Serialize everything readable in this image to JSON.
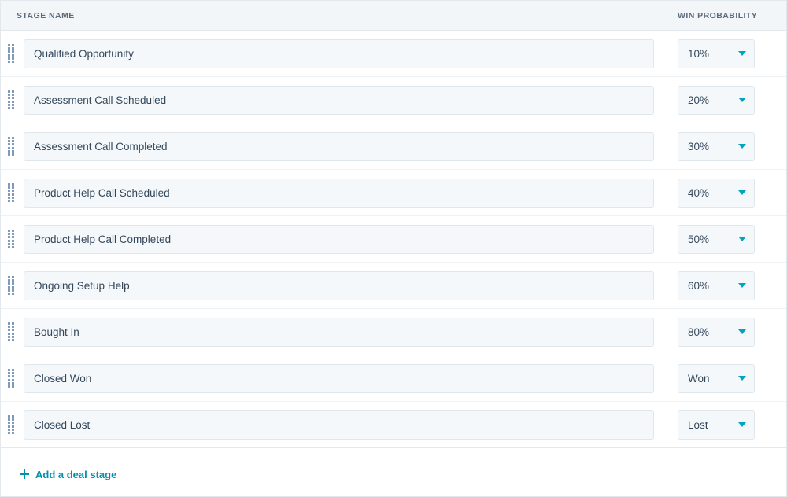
{
  "table": {
    "columns": {
      "stage_name": "STAGE NAME",
      "win_probability": "WIN PROBABILITY"
    },
    "rows": [
      {
        "stage_name": "Qualified Opportunity",
        "win_probability": "10%"
      },
      {
        "stage_name": "Assessment Call Scheduled",
        "win_probability": "20%"
      },
      {
        "stage_name": "Assessment Call Completed",
        "win_probability": "30%"
      },
      {
        "stage_name": "Product Help Call Scheduled",
        "win_probability": "40%"
      },
      {
        "stage_name": "Product Help Call Completed",
        "win_probability": "50%"
      },
      {
        "stage_name": "Ongoing Setup Help",
        "win_probability": "60%"
      },
      {
        "stage_name": "Bought In",
        "win_probability": "80%"
      },
      {
        "stage_name": "Closed Won",
        "win_probability": "Won"
      },
      {
        "stage_name": "Closed Lost",
        "win_probability": "Lost"
      }
    ]
  },
  "footer": {
    "add_stage_label": "Add a deal stage"
  },
  "colors": {
    "accent": "#00a4bd",
    "link": "#0091ae",
    "text": "#33475b",
    "header_text": "#5b6b7c",
    "header_bg": "#f3f6f8",
    "field_bg": "#f5f8fa",
    "field_border": "#dfe7ed",
    "row_divider": "#eef2f5",
    "panel_border": "#e3e8ed",
    "drag_dot": "#7c98b6"
  }
}
